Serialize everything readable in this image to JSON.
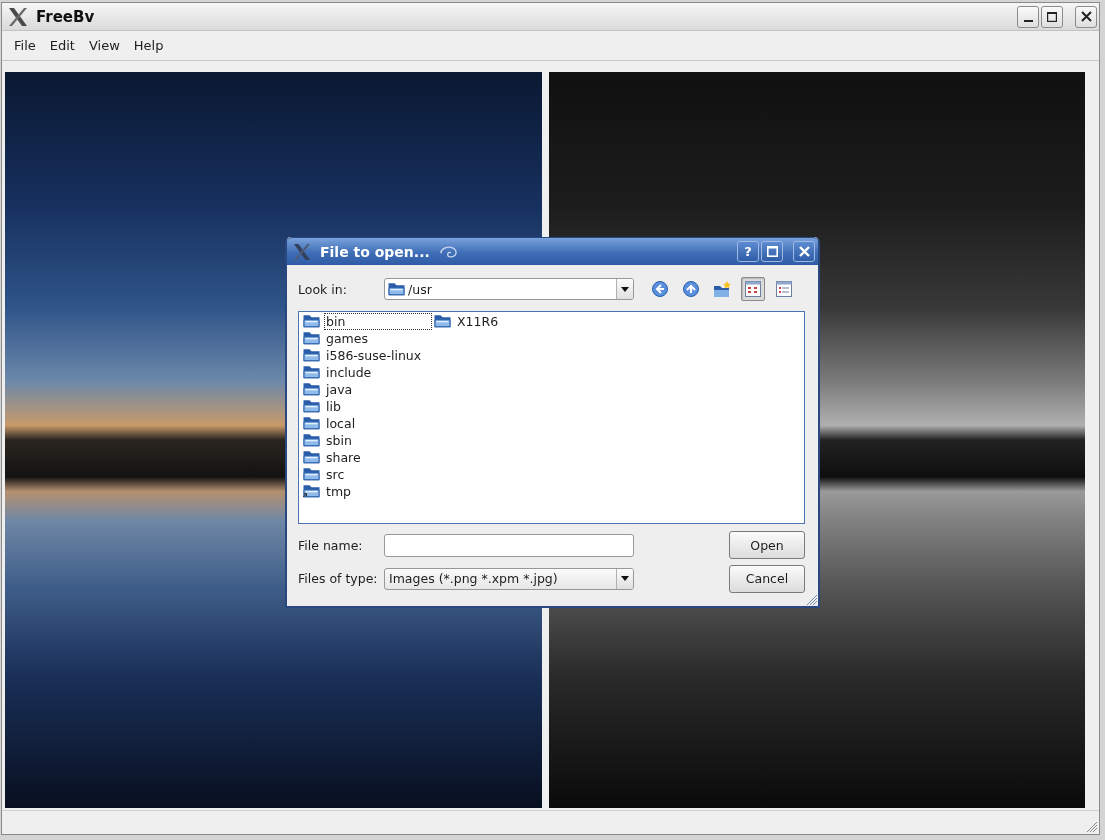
{
  "window": {
    "title": "FreeBv"
  },
  "menu": [
    {
      "label": "File"
    },
    {
      "label": "Edit"
    },
    {
      "label": "View"
    },
    {
      "label": "Help"
    }
  ],
  "panels": [
    {
      "kind": "color"
    },
    {
      "kind": "grayscale"
    }
  ],
  "dialog": {
    "title": "File to open...",
    "help_button": "?",
    "look_in": {
      "label": "Look in:",
      "value": "/usr"
    },
    "actions": [
      {
        "kind": "back"
      },
      {
        "kind": "up"
      },
      {
        "kind": "new_folder"
      }
    ],
    "views": [
      {
        "kind": "list",
        "selected": true
      },
      {
        "kind": "detail",
        "selected": false
      }
    ],
    "files": [
      {
        "name": "bin",
        "focused": true,
        "symlink": false
      },
      {
        "name": "games",
        "focused": false,
        "symlink": false
      },
      {
        "name": "i586-suse-linux",
        "focused": false,
        "symlink": false
      },
      {
        "name": "include",
        "focused": false,
        "symlink": false
      },
      {
        "name": "java",
        "focused": false,
        "symlink": false
      },
      {
        "name": "lib",
        "focused": false,
        "symlink": false
      },
      {
        "name": "local",
        "focused": false,
        "symlink": false
      },
      {
        "name": "sbin",
        "focused": false,
        "symlink": false
      },
      {
        "name": "share",
        "focused": false,
        "symlink": false
      },
      {
        "name": "src",
        "focused": false,
        "symlink": false
      },
      {
        "name": "tmp",
        "focused": false,
        "symlink": true
      },
      {
        "name": "X11R6",
        "focused": false,
        "symlink": false
      }
    ],
    "file_name": {
      "label": "File name:"
    },
    "file_type": {
      "label": "Files of type:",
      "value": "Images (*.png *.xpm *.jpg)"
    },
    "buttons": [
      {
        "label": "Open"
      },
      {
        "label": "Cancel"
      }
    ]
  }
}
